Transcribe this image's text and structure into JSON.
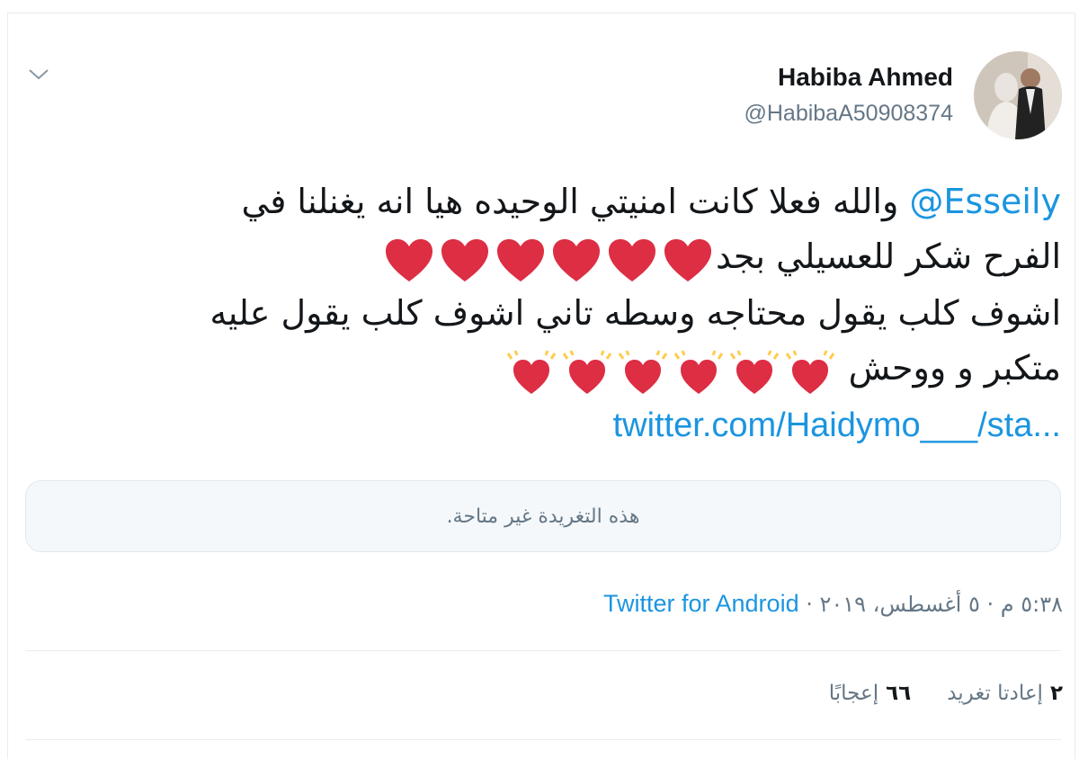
{
  "author": {
    "name": "Habiba Ahmed",
    "handle": "@HabibaA50908374"
  },
  "tweet": {
    "mention": "@Esseily",
    "line1_text": "والله فعلا كانت امنيتي الوحيده هيا انه يغنلنا في",
    "line2_text": "الفرح شكر للعسيلي بجد",
    "line3_text": "اشوف كلب يقول محتاجه وسطه تاني اشوف كلب يقول عليه",
    "line4_text": "متكبر و ووحش",
    "link": "twitter.com/Haidymo___/sta...",
    "emoji_red_heart": "red-heart",
    "emoji_growing_heart": "growing-heart"
  },
  "quoted": {
    "unavailable_text": "هذه التغريدة غير متاحة."
  },
  "meta": {
    "time_date": "٥:٣٨ م · ٥ أغسطس، ٢٠١٩ · ",
    "source": "Twitter for Android"
  },
  "stats": {
    "retweets_count": "٢",
    "retweets_label": "إعادتا تغريد",
    "likes_count": "٦٦",
    "likes_label": "إعجابًا"
  },
  "colors": {
    "link": "#1b95e0",
    "text": "#14171a",
    "muted": "#657786",
    "heart": "#dd2e44"
  }
}
